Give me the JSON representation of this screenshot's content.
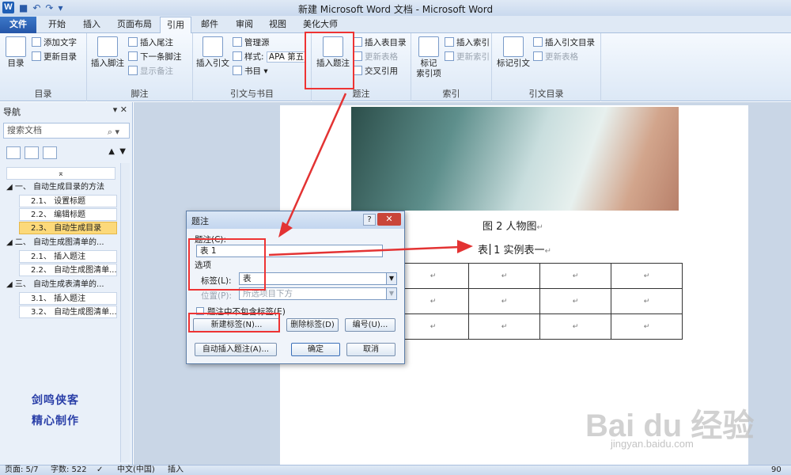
{
  "window": {
    "title": "新建 Microsoft Word 文档 - Microsoft Word",
    "app_icon": "W"
  },
  "tabs": [
    {
      "label": "文件"
    },
    {
      "label": "开始"
    },
    {
      "label": "插入"
    },
    {
      "label": "页面布局"
    },
    {
      "label": "引用"
    },
    {
      "label": "邮件"
    },
    {
      "label": "审阅"
    },
    {
      "label": "视图"
    },
    {
      "label": "美化大师"
    }
  ],
  "ribbon": {
    "toc": {
      "big": "目录",
      "add_text": "添加文字",
      "update": "更新目录",
      "label": "目录"
    },
    "footnote": {
      "big": "插入脚注",
      "insert_endnote": "插入尾注",
      "next_footnote": "下一条脚注",
      "show_notes": "显示备注",
      "label": "脚注"
    },
    "citation": {
      "big": "插入引文",
      "manage": "管理源",
      "style_prefix": "样式:",
      "style_value": "APA 第五",
      "bibliography": "书目",
      "label": "引文与书目"
    },
    "caption": {
      "big": "插入题注",
      "insert_table_figures": "插入表目录",
      "update_table": "更新表格",
      "cross_ref": "交叉引用",
      "label": "题注"
    },
    "index": {
      "big_line1": "标记",
      "big_line2": "索引项",
      "insert_index": "插入索引",
      "update_index": "更新索引",
      "label": "索引"
    },
    "toa": {
      "big": "标记引文",
      "insert_toa": "插入引文目录",
      "update_table": "更新表格",
      "label": "引文目录"
    }
  },
  "nav": {
    "title": "导航",
    "search_placeholder": "搜索文档",
    "items": [
      {
        "text": "一、 自动生成目录的方法",
        "level": 1
      },
      {
        "text": "2.1、 设置标题",
        "level": 2
      },
      {
        "text": "2.2、 编辑标题",
        "level": 2
      },
      {
        "text": "2.3、 自动生成目录",
        "level": 2,
        "selected": true
      },
      {
        "text": "二、 自动生成图清单的...",
        "level": 1
      },
      {
        "text": "2.1、 插入题注",
        "level": 2
      },
      {
        "text": "2.2、 自动生成图清单...",
        "level": 2
      },
      {
        "text": "三、 自动生成表清单的...",
        "level": 1
      },
      {
        "text": "3.1、 插入题注",
        "level": 2
      },
      {
        "text": "3.2、 自动生成图清单...",
        "level": 2
      }
    ],
    "signature_line1": "剑鸣侠客",
    "signature_line2": "精心制作"
  },
  "document": {
    "figure_caption": "图 2 人物图",
    "table_caption_prefix": "表",
    "table_caption_rest": "1 实例表一",
    "para_mark": "↵"
  },
  "dialog": {
    "title": "题注",
    "help": "?",
    "close": "✕",
    "caption_label": "题注(C):",
    "caption_value": "表 1",
    "options_label": "选项",
    "label_label": "标签(L):",
    "label_value": "表",
    "position_label": "位置(P):",
    "position_value": "所选项目下方",
    "exclude_label": "题注中不包含标签(E)",
    "new_label_btn": "新建标签(N)...",
    "delete_label_btn": "删除标签(D)",
    "numbering_btn": "编号(U)...",
    "auto_caption_btn": "自动插入题注(A)...",
    "ok_btn": "确定",
    "cancel_btn": "取消"
  },
  "statusbar": {
    "page": "页面: 5/7",
    "words": "字数: 522",
    "language": "中文(中国)",
    "mode": "插入",
    "zoom": "90"
  },
  "watermark": {
    "main": "Bai du 经验",
    "sub": "jingyan.baidu.com"
  },
  "colors": {
    "accent": "#2556a8",
    "highlight": "#e33333",
    "selected_nav": "#fcd97a"
  }
}
